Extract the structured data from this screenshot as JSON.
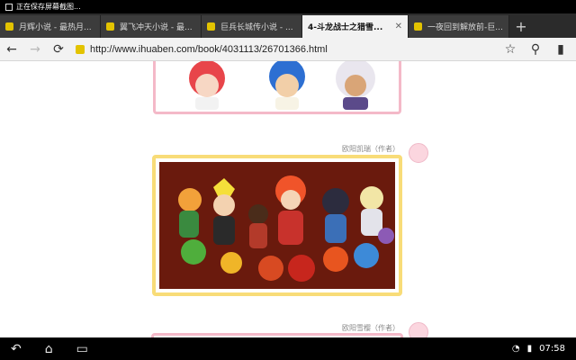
{
  "status_bar": {
    "notification": "正在保存屏幕截图..."
  },
  "tabs": [
    {
      "label": "月辉小说 - 最热月..."
    },
    {
      "label": "翼飞冲天小说 - 最..."
    },
    {
      "label": "巨兵长城传小说 - ..."
    },
    {
      "label": "4-斗龙战士之猎雪..."
    },
    {
      "label": "一夜回到解放前-巨..."
    }
  ],
  "toolbar": {
    "url": "http://www.ihuaben.com/book/4031113/26701366.html"
  },
  "content": {
    "message_1": {
      "author": "欧阳凯瑞（作者）"
    },
    "message_2": {
      "author": "欧阳雪樱（作者）"
    }
  },
  "system_bar": {
    "time": "07:58"
  },
  "colors": {
    "pink_frame": "#f4b9c8",
    "yellow_frame": "#f8dc78",
    "favicon": "#e3c300"
  }
}
